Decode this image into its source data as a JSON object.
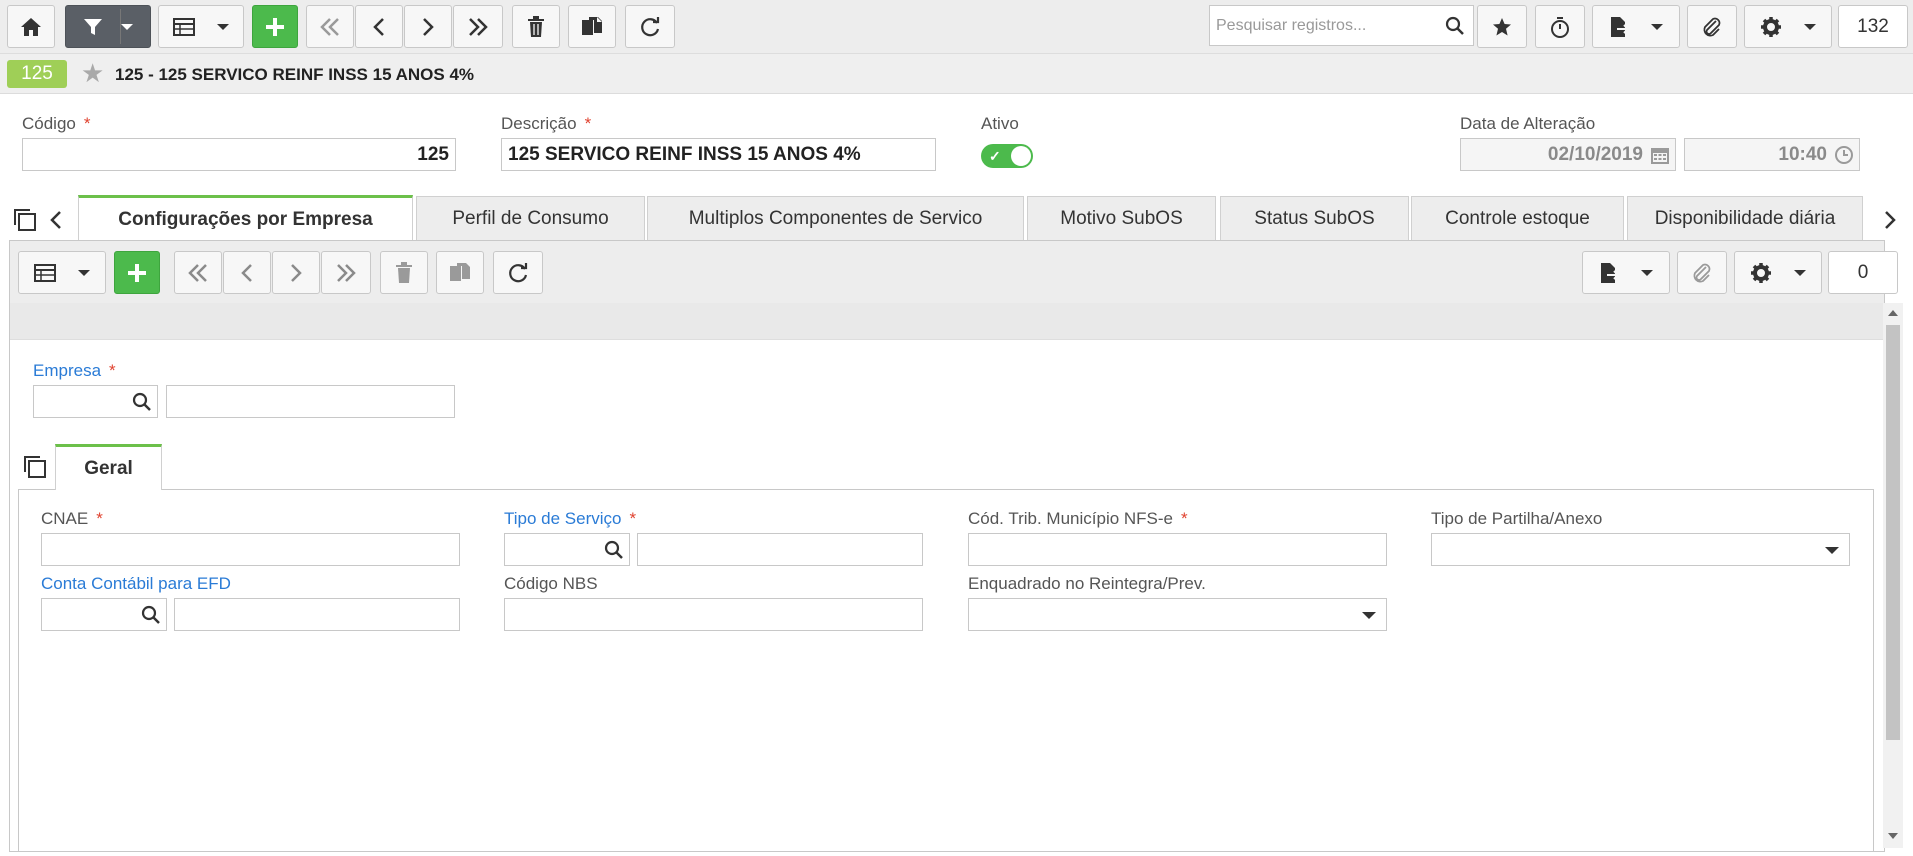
{
  "toolbar": {
    "search_placeholder": "Pesquisar registros...",
    "record_count": "132"
  },
  "header": {
    "record_badge": "125",
    "title": "125 - 125 SERVICO REINF INSS 15 ANOS 4%"
  },
  "form": {
    "codigo_label": "Código",
    "codigo_value": "125",
    "descricao_label": "Descrição",
    "descricao_value": "125 SERVICO REINF INSS 15 ANOS 4%",
    "ativo_label": "Ativo",
    "ativo_on": true,
    "data_alteracao_label": "Data de Alteração",
    "data_value": "02/10/2019",
    "hora_value": "10:40",
    "required_mark": "*"
  },
  "tabs": [
    {
      "label": "Configurações por Empresa",
      "active": true
    },
    {
      "label": "Perfil de Consumo"
    },
    {
      "label": "Multiplos Componentes de Servico"
    },
    {
      "label": "Motivo SubOS"
    },
    {
      "label": "Status SubOS"
    },
    {
      "label": "Controle estoque"
    },
    {
      "label": "Disponibilidade diária"
    }
  ],
  "subtoolbar": {
    "record_count": "0"
  },
  "empresa_section": {
    "empresa_label": "Empresa"
  },
  "inner_tab": {
    "label": "Geral"
  },
  "geral": {
    "cnae_label": "CNAE",
    "tipo_servico_label": "Tipo de Serviço",
    "cod_trib_label": "Cód. Trib. Município NFS-e",
    "tipo_partilha_label": "Tipo de Partilha/Anexo",
    "conta_contabil_label": "Conta Contábil para EFD",
    "codigo_nbs_label": "Código NBS",
    "enquadrado_label": "Enquadrado no Reintegra/Prev."
  },
  "colors": {
    "accent_green": "#4cba4c",
    "badge_green": "#9fcf57",
    "required_red": "#e0422f",
    "link_blue": "#2a7bd6"
  }
}
